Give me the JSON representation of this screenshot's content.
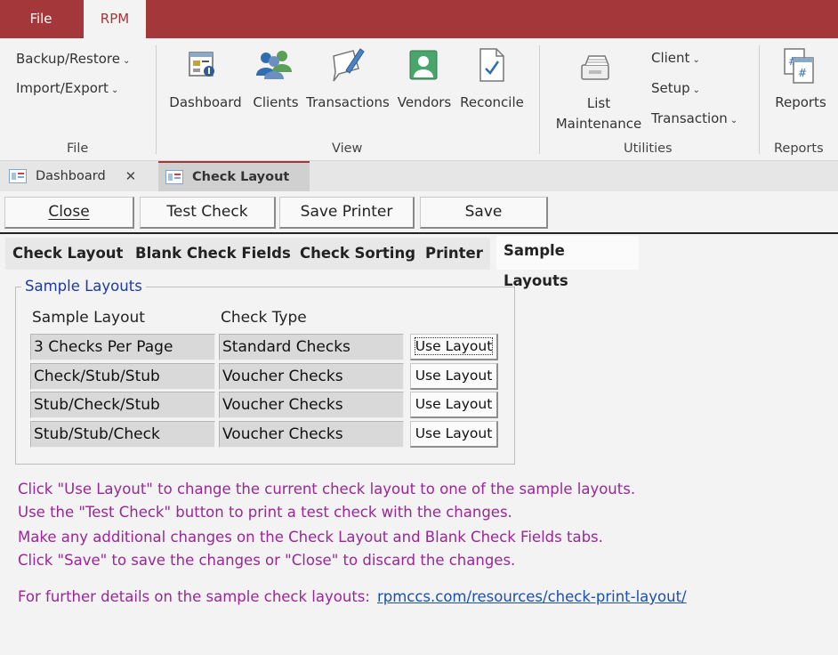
{
  "ribbon_tabs": {
    "file": "File",
    "rpm": "RPM"
  },
  "ribbon": {
    "file_group": {
      "backup_restore": "Backup/Restore",
      "import_export": "Import/Export",
      "label": "File"
    },
    "view_group": {
      "dashboard": "Dashboard",
      "clients": "Clients",
      "transactions": "Transactions",
      "vendors": "Vendors",
      "reconcile": "Reconcile",
      "label": "View"
    },
    "utilities_group": {
      "list": "List",
      "maintenance": "Maintenance",
      "client": "Client",
      "setup": "Setup",
      "transaction": "Transaction",
      "label": "Utilities"
    },
    "reports_group": {
      "reports": "Reports",
      "label": "Reports"
    }
  },
  "doc_tabs": [
    {
      "label": "Dashboard",
      "close": "✕"
    },
    {
      "label": "Check Layout"
    }
  ],
  "commands": {
    "close": "Close",
    "test_check": "Test Check",
    "save_printer": "Save Printer",
    "save": "Save"
  },
  "inner_tabs": [
    "Check Layout",
    "Blank Check Fields",
    "Check Sorting",
    "Printer",
    "Sample Layouts"
  ],
  "sample_layouts": {
    "title": "Sample Layouts",
    "col_layout": "Sample Layout",
    "col_type": "Check Type",
    "rows": [
      {
        "layout": "3 Checks Per Page",
        "type": "Standard Checks",
        "button": "Use Layout"
      },
      {
        "layout": "Check/Stub/Stub",
        "type": "Voucher Checks",
        "button": "Use Layout"
      },
      {
        "layout": "Stub/Check/Stub",
        "type": "Voucher Checks",
        "button": "Use Layout"
      },
      {
        "layout": "Stub/Stub/Check",
        "type": "Voucher Checks",
        "button": "Use Layout"
      }
    ]
  },
  "instructions": [
    "Click \"Use Layout\" to change the current check layout to one of the sample layouts.",
    "Use the \"Test Check\" button to print a test check with the changes.",
    "Make any additional changes on the Check Layout and Blank Check Fields tabs.",
    "Click \"Save\" to save the changes or \"Close\" to discard the changes."
  ],
  "details": {
    "text": "For further details on the sample check layouts:",
    "link": "rpmccs.com/resources/check-print-layout/"
  },
  "colors": {
    "accent": "#a4373a",
    "instruction": "#9b2698",
    "link": "#1a4fb3",
    "groupbox_title": "#1f3aa5"
  }
}
